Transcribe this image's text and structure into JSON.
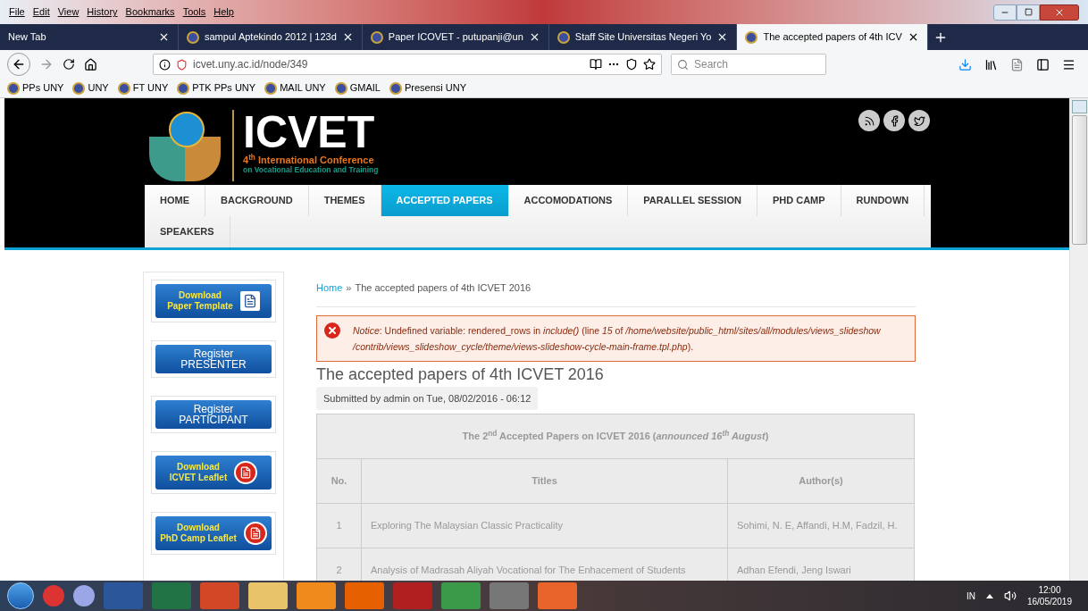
{
  "browser": {
    "menu": [
      "File",
      "Edit",
      "View",
      "History",
      "Bookmarks",
      "Tools",
      "Help"
    ],
    "tabs": [
      {
        "title": "New Tab",
        "kind": "newtab",
        "selected": false
      },
      {
        "title": "sampul Aptekindo 2012 | 123d",
        "kind": "page",
        "selected": false
      },
      {
        "title": "Paper ICOVET - putupanji@un",
        "kind": "page",
        "selected": false
      },
      {
        "title": "Staff Site Universitas Negeri Yo",
        "kind": "page",
        "selected": false
      },
      {
        "title": "The accepted papers of 4th ICV",
        "kind": "page",
        "selected": true
      }
    ],
    "url": "icvet.uny.ac.id/node/349",
    "search": {
      "placeholder": "Search"
    },
    "bookmarks": [
      "PPs UNY",
      "UNY",
      "FT UNY",
      "PTK PPs UNY",
      "MAIL UNY",
      "GMAIL",
      "Presensi UNY"
    ]
  },
  "site": {
    "logo": {
      "title": "ICVET",
      "subtitle": "4$^{th}$ International Conference",
      "tagline": "on Vocational Education and Training"
    },
    "nav": [
      {
        "label": "HOME",
        "selected": false
      },
      {
        "label": "BACKGROUND",
        "selected": false
      },
      {
        "label": "THEMES",
        "selected": false
      },
      {
        "label": "ACCEPTED PAPERS",
        "selected": true
      },
      {
        "label": "ACCOMODATIONS",
        "selected": false
      },
      {
        "label": "PARALLEL SESSION",
        "selected": false
      },
      {
        "label": "PHD CAMP",
        "selected": false
      },
      {
        "label": "RUNDOWN",
        "selected": false
      },
      {
        "label": "SPEAKERS",
        "selected": false
      }
    ],
    "sidebar": [
      {
        "kind": "word",
        "line1": "Download",
        "line2": "Paper Template"
      },
      {
        "kind": "register",
        "line1": "Register",
        "line2": "PRESENTER"
      },
      {
        "kind": "register",
        "line1": "Register",
        "line2": "PARTICIPANT"
      },
      {
        "kind": "pdf",
        "line1": "Download",
        "line2": "ICVET Leaflet"
      },
      {
        "kind": "pdf",
        "line1": "Download",
        "line2": "PhD Camp Leaflet"
      }
    ],
    "breadcrumb": {
      "home": "Home",
      "separator": "»",
      "current": "The accepted papers of 4th ICVET 2016"
    },
    "notice": "*Notice*: Undefined variable: rendered_rows in *include()* (line *15* of */home/website/public_html/sites/all/modules/views_slideshow /contrib/views_slideshow_cycle/theme/views-slideshow-cycle-main-frame.tpl.php*).",
    "title": "The accepted papers of 4th ICVET 2016",
    "submitted": "Submitted by admin on Tue, 08/02/2016 - 06:12",
    "table": {
      "caption": "The 2$^{nd}$ Accepted Papers on ICVET 2016 (*announced 16$^{th}$ August*)",
      "columns": [
        "No.",
        "Titles",
        "Author(s)"
      ],
      "rows": [
        [
          "1",
          "Exploring The Malaysian Classic Practicality",
          "Sohimi, N. E, Affandi, H.M, Fadzil, H."
        ],
        [
          "2",
          "Analysis of Madrasah Aliyah Vocational for The Enhacement of Students",
          "Adhan Efendi, Jeng Iswari"
        ]
      ]
    }
  },
  "taskbar": {
    "language": "IN",
    "time": "12:00",
    "date": "16/05/2019"
  }
}
